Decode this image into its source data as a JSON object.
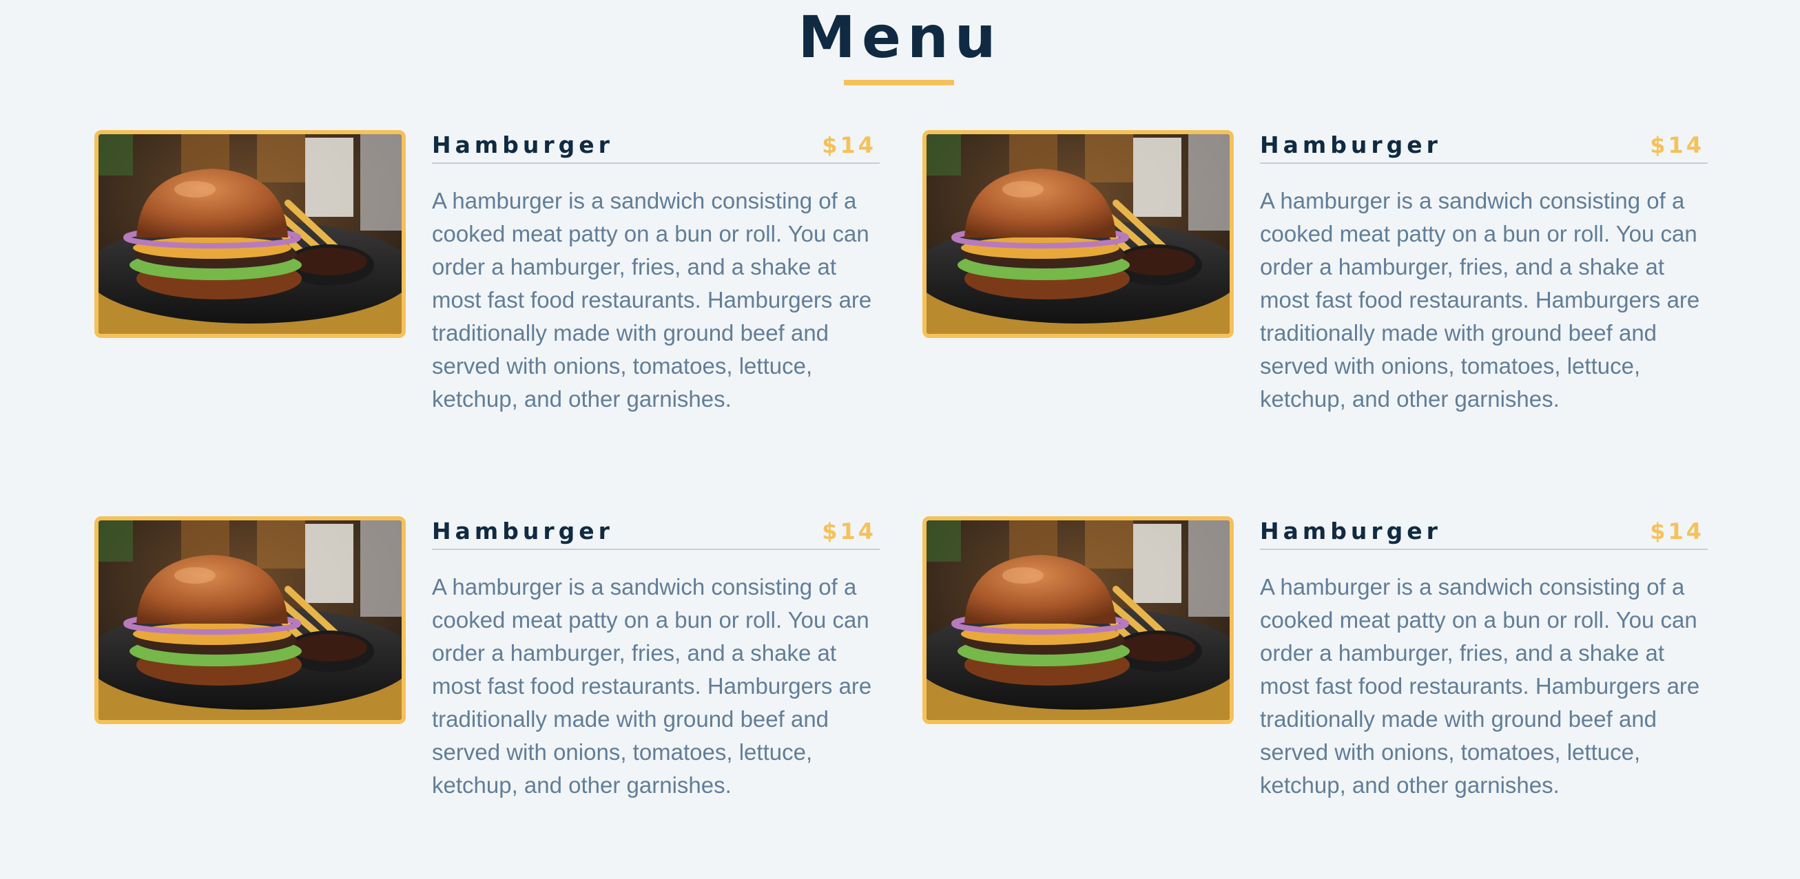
{
  "page": {
    "title": "Menu"
  },
  "colors": {
    "background": "#f1f5f8",
    "heading": "#102a42",
    "accent": "#f5c15a",
    "body_text": "#617d98",
    "divider": "#c6ced6"
  },
  "menu_items": [
    {
      "name": "Hamburger",
      "price": "$14",
      "description": "A hamburger is a sandwich consisting of a cooked meat patty on a bun or roll. You can order a hamburger, fries, and a shake at most fast food restaurants. Hamburgers are traditionally made with ground beef and served with onions, tomatoes, lettuce, ketchup, and other garnishes.",
      "image": "hamburger-photo"
    },
    {
      "name": "Hamburger",
      "price": "$14",
      "description": "A hamburger is a sandwich consisting of a cooked meat patty on a bun or roll. You can order a hamburger, fries, and a shake at most fast food restaurants. Hamburgers are traditionally made with ground beef and served with onions, tomatoes, lettuce, ketchup, and other garnishes.",
      "image": "hamburger-photo"
    },
    {
      "name": "Hamburger",
      "price": "$14",
      "description": "A hamburger is a sandwich consisting of a cooked meat patty on a bun or roll. You can order a hamburger, fries, and a shake at most fast food restaurants. Hamburgers are traditionally made with ground beef and served with onions, tomatoes, lettuce, ketchup, and other garnishes.",
      "image": "hamburger-photo"
    },
    {
      "name": "Hamburger",
      "price": "$14",
      "description": "A hamburger is a sandwich consisting of a cooked meat patty on a bun or roll. You can order a hamburger, fries, and a shake at most fast food restaurants. Hamburgers are traditionally made with ground beef and served with onions, tomatoes, lettuce, ketchup, and other garnishes.",
      "image": "hamburger-photo"
    }
  ]
}
